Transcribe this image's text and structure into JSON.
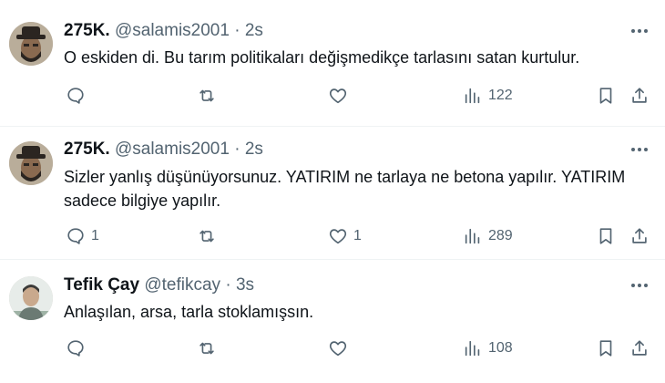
{
  "tweets": [
    {
      "name": "275K.",
      "handle": "@salamis2001",
      "separator": "·",
      "time": "2s",
      "text": "O eskiden di. Bu tarım politikaları değişmedikçe tarlasını satan kurtulur.",
      "replies": "",
      "retweets": "",
      "likes": "",
      "views": "122",
      "avatar_icon": "bearded-man-hat-avatar"
    },
    {
      "name": "275K.",
      "handle": "@salamis2001",
      "separator": "·",
      "time": "2s",
      "text": "Sizler yanlış düşünüyorsunuz. YATIRIM ne tarlaya ne betona yapılır. YATIRIM sadece bilgiye yapılır.",
      "replies": "1",
      "retweets": "",
      "likes": "1",
      "views": "289",
      "avatar_icon": "bearded-man-hat-avatar"
    },
    {
      "name": "Tefik Çay",
      "handle": "@tefikcay",
      "separator": "·",
      "time": "3s",
      "text": "Anlaşılan, arsa, tarla stoklamışsın.",
      "replies": "",
      "retweets": "",
      "likes": "",
      "views": "108",
      "avatar_icon": "man-portrait-avatar"
    }
  ],
  "colors": {
    "text": "#0f1419",
    "muted": "#536471",
    "divider": "#eff3f4"
  },
  "icons": [
    "reply-icon",
    "retweet-icon",
    "like-icon",
    "views-icon",
    "bookmark-icon",
    "share-icon",
    "more-icon"
  ]
}
